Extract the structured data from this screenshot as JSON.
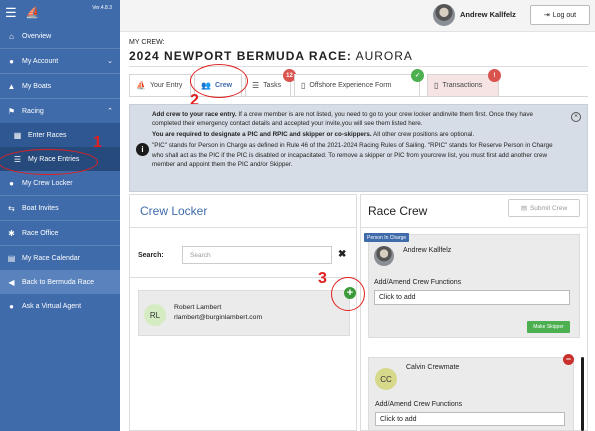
{
  "sidebar": {
    "logo": "bermuda race logo",
    "version": "Ver.4.8.3",
    "items": [
      {
        "label": "Overview",
        "icon": "home-icon"
      },
      {
        "label": "My Account",
        "icon": "user-icon"
      },
      {
        "label": "My Boats",
        "icon": "boat-icon"
      },
      {
        "label": "Racing",
        "icon": "flag-icon"
      },
      {
        "label": "Enter Races",
        "icon": "calendar-icon"
      },
      {
        "label": "My Race Entries",
        "icon": "list-icon"
      },
      {
        "label": "My Crew Locker",
        "icon": "users-icon"
      },
      {
        "label": "Boat Invites",
        "icon": "link-icon"
      },
      {
        "label": "Race Office",
        "icon": "gear-icon"
      },
      {
        "label": "My Race Calendar",
        "icon": "calendar-icon"
      },
      {
        "label": "Back to Bermuda Race",
        "icon": "back-icon"
      },
      {
        "label": "Ask a Virtual Agent",
        "icon": "chat-icon"
      }
    ]
  },
  "header": {
    "username": "Andrew Kallfelz",
    "logout_label": "Log out"
  },
  "page": {
    "crew_label": "MY CREW:",
    "race_name": "2024 NEWPORT BERMUDA RACE:",
    "boat_name": "AURORA"
  },
  "tabs": [
    {
      "label": "Your Entry"
    },
    {
      "label": "Crew"
    },
    {
      "label": "Tasks",
      "badge": "12"
    },
    {
      "label": "Offshore Experience Form",
      "badge": "✓"
    },
    {
      "label": "Transactions",
      "badge": "!"
    }
  ],
  "info": {
    "p1_bold": "Add crew to your race entry.",
    "p1_text": " If a crew member is are not listed, you need to go to your crew locker andinvite them first. Once they have completed their emergency contact details and accepted your invite,you will see them listed here.",
    "p2_bold": "You are required to designate a PIC and RPIC and skipper or co-skippers.",
    "p2_text": " All other crew positions are optional.",
    "p3": "\"PIC\" stands for Person in Charge as defined in Rule 46 of the 2021-2024 Racing Rules of Sailing. \"RPIC\" stands for Reserve Person in Charge who shall act as the PIC if the PIC is disabled or incapacitated. To remove a skipper or PIC from yourcrew list, you must first add another crew member and appoint them the PIC and/or Skipper."
  },
  "crew_locker": {
    "title": "Crew Locker",
    "search_label": "Search:",
    "search_placeholder": "Search",
    "member": {
      "initials": "RL",
      "name": "Robert Lambert",
      "email": "rlambert@burginlambert.com"
    }
  },
  "race_crew": {
    "title": "Race Crew",
    "submit_label": "Submit Crew",
    "pic_badge": "Person In Charge",
    "members": [
      {
        "name": "Andrew Kallfelz",
        "func_label": "Add/Amend Crew Functions",
        "func_value": "Click to add",
        "action": "Make Skipper"
      },
      {
        "initials": "CC",
        "name": "Calvin Crewmate",
        "func_label": "Add/Amend Crew Functions",
        "func_value": "Click to add"
      }
    ]
  },
  "annotations": [
    "1",
    "2",
    "3"
  ],
  "colors": {
    "sidebar": "#3f6bab",
    "annotation": "#e02020",
    "add": "#3a9a3a",
    "remove": "#c9302c"
  }
}
